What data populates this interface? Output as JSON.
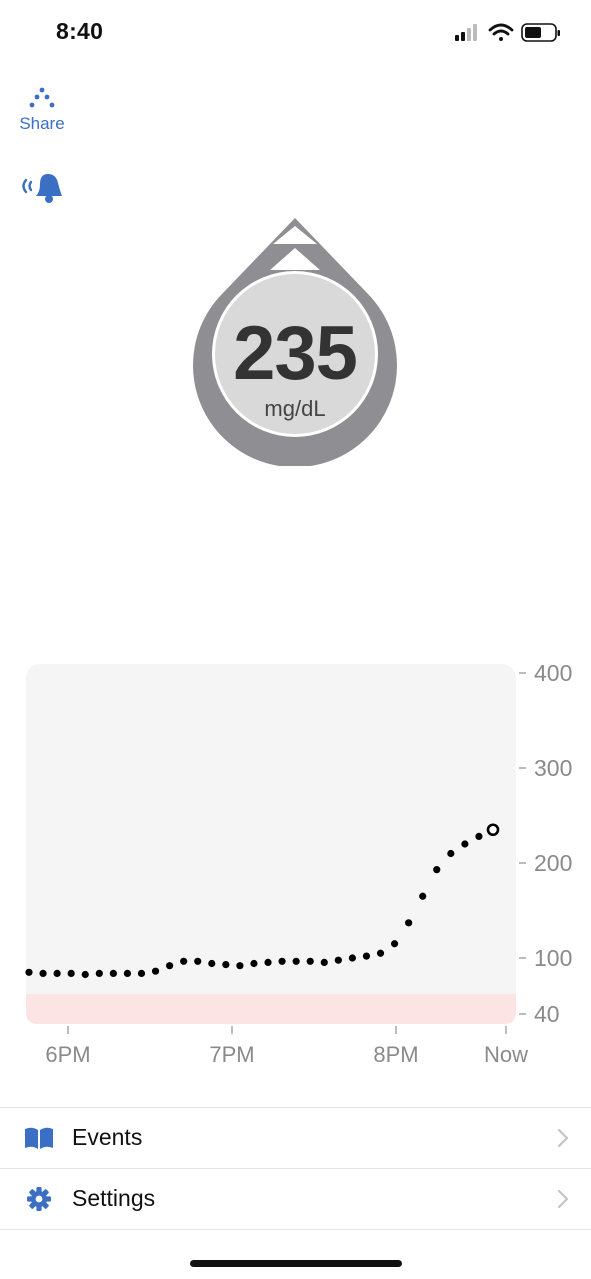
{
  "status_bar": {
    "time": "8:40"
  },
  "actions": {
    "share_label": "Share"
  },
  "reading": {
    "value": "235",
    "unit": "mg/dL",
    "trend": "rising-quickly"
  },
  "chart_data": {
    "type": "scatter",
    "title": "",
    "xlabel": "",
    "ylabel": "",
    "x_tick_labels": [
      "6PM",
      "7PM",
      "8PM",
      "Now"
    ],
    "y_tick_labels": [
      "400",
      "300",
      "200",
      "100",
      "40"
    ],
    "ylim": [
      40,
      400
    ],
    "low_range_band": [
      40,
      70
    ],
    "x_minutes_from_start": [
      0,
      5,
      10,
      15,
      20,
      25,
      30,
      35,
      40,
      45,
      50,
      55,
      60,
      65,
      70,
      75,
      80,
      85,
      90,
      95,
      100,
      105,
      110,
      115,
      120,
      125,
      130,
      135,
      140,
      145,
      150,
      155,
      160,
      165,
      170,
      175,
      180
    ],
    "values": [
      87,
      86,
      86,
      86,
      85,
      86,
      86,
      86,
      86,
      88,
      93,
      97,
      97,
      95,
      94,
      93,
      95,
      96,
      97,
      97,
      97,
      96,
      98,
      100,
      102,
      105,
      115,
      137,
      165,
      193,
      210,
      220,
      228,
      235
    ],
    "current_point_index": 33,
    "colors": {
      "point": "#000000",
      "low_band": "#fce4e4",
      "plot_bg": "#f5f5f5",
      "axis_text": "#8a8a8a"
    }
  },
  "menu": {
    "items": [
      {
        "label": "Events",
        "icon": "book-icon"
      },
      {
        "label": "Settings",
        "icon": "gear-icon"
      }
    ]
  },
  "colors": {
    "accent": "#3a6fc4",
    "badge_gray": "#8e8e93",
    "badge_fill": "#d9d9d9"
  }
}
